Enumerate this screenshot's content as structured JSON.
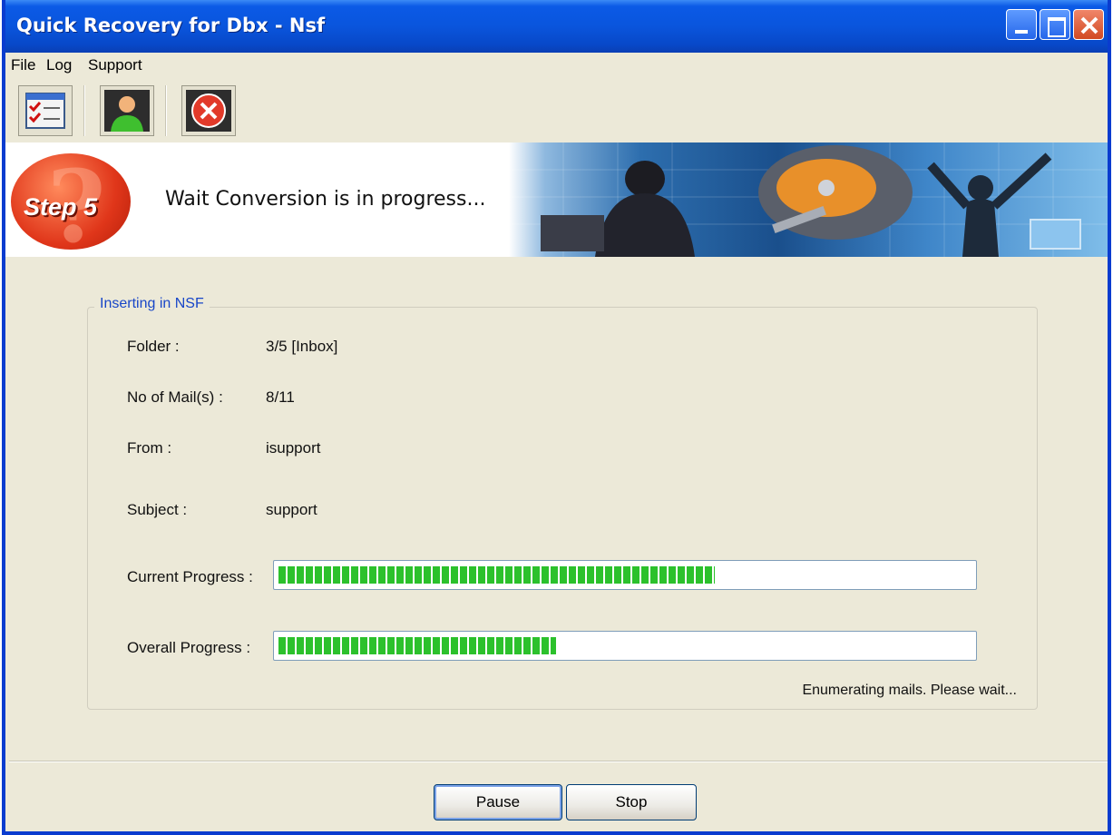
{
  "window": {
    "title": "Quick Recovery for Dbx - Nsf"
  },
  "menu": {
    "items": [
      "File",
      "Log",
      "Support"
    ]
  },
  "toolbar": {
    "icons": [
      "checklist-icon",
      "user-icon",
      "close-circle-icon"
    ]
  },
  "banner": {
    "step_label": "Step 5",
    "message": "Wait Conversion is in progress..."
  },
  "group": {
    "title": "Inserting in NSF",
    "folder_label": "Folder :",
    "folder_value": "3/5  [Inbox]",
    "mails_label": "No of Mail(s) :",
    "mails_value": "8/11",
    "from_label": "From :",
    "from_value": "isupport",
    "subject_label": "Subject :",
    "subject_value": "support",
    "current_progress_label": "Current Progress :",
    "current_progress_percent": 63,
    "overall_progress_label": "Overall Progress :",
    "overall_progress_percent": 40,
    "status_text": "Enumerating mails. Please wait..."
  },
  "buttons": {
    "pause": "Pause",
    "stop": "Stop"
  },
  "colors": {
    "titlebar": "#0a55dd",
    "progress": "#2cc12c",
    "group_title": "#1846c8"
  }
}
